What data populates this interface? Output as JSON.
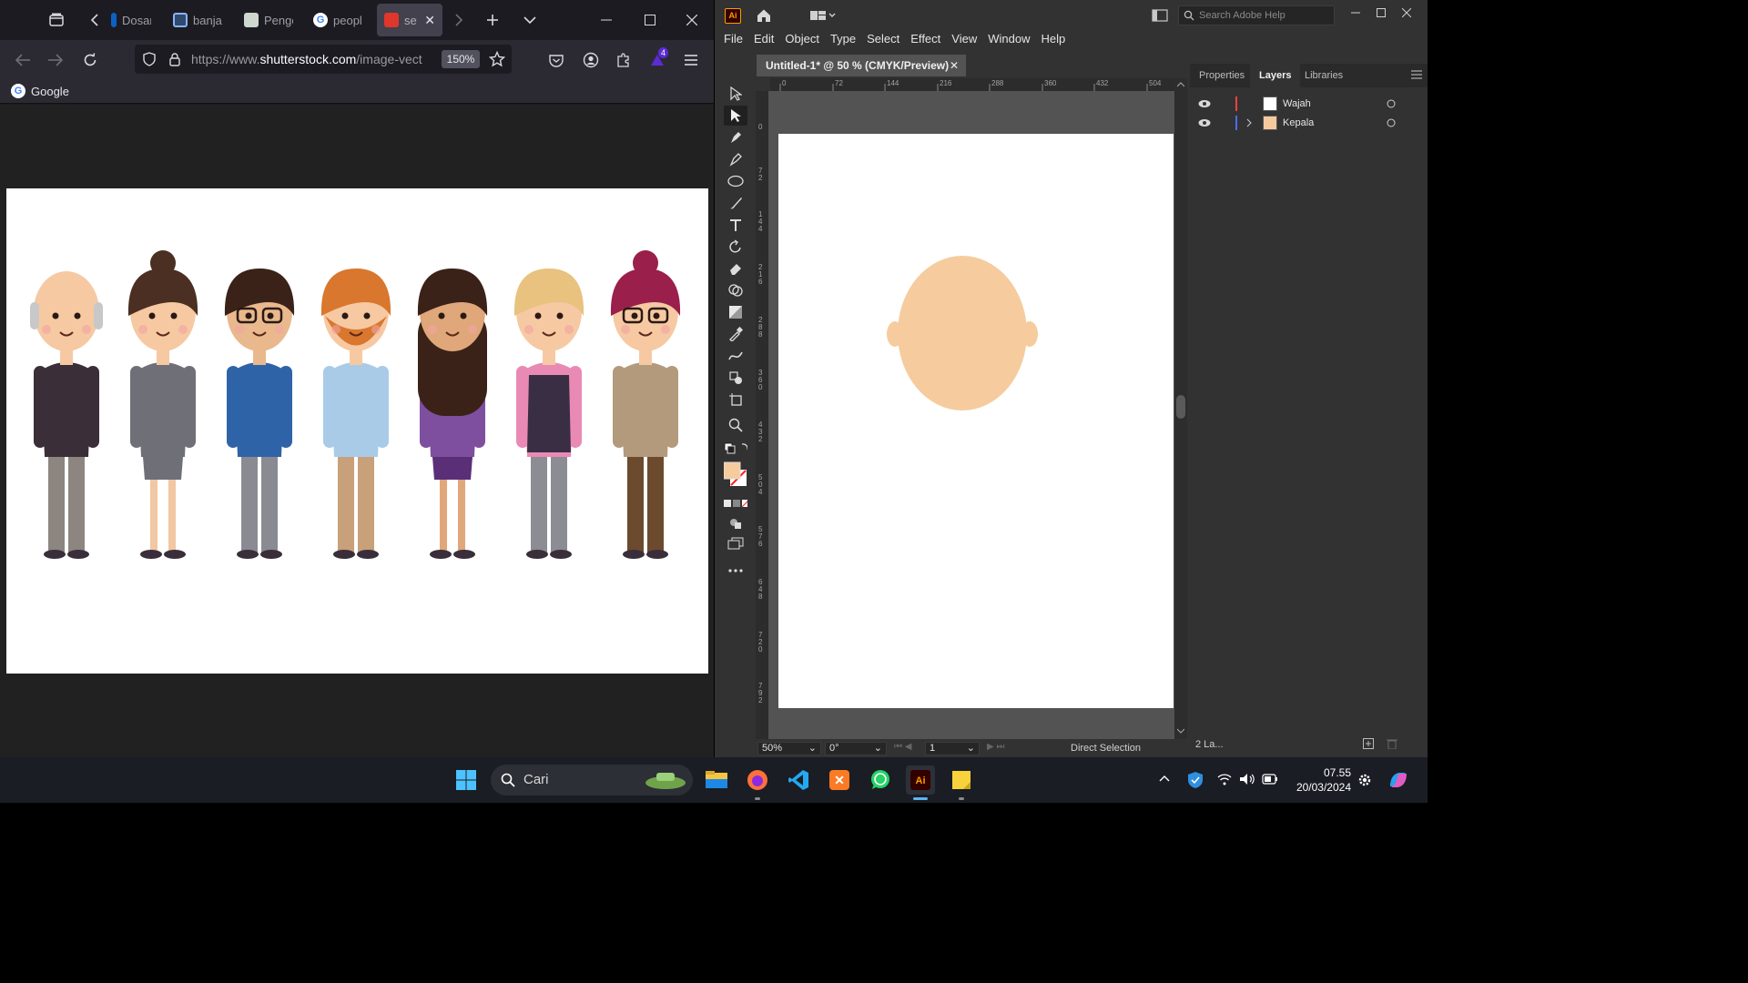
{
  "firefox": {
    "tabs": [
      {
        "label": "Dosan",
        "favicon_color": "#0a63c2"
      },
      {
        "label": "banjar",
        "favicon_color": "#8ab4f8"
      },
      {
        "label": "Penge",
        "favicon_color": "#7a9a7a"
      },
      {
        "label": "peopl",
        "favicon_color": "#4285f4"
      },
      {
        "label": "set",
        "favicon_color": "#e0362c",
        "active": true
      }
    ],
    "url_prefix": "https://www.",
    "url_domain": "shutterstock.com",
    "url_path": "/image-vect",
    "zoom": "150%",
    "extension_badge": "4",
    "bookmark": "Google",
    "people": [
      {
        "hair": "#c8c8c8",
        "skin": "#f6c9a2",
        "top": "#3a2e38",
        "pants": "#8c8580",
        "glasses": false,
        "beard": false,
        "bald": true
      },
      {
        "hair": "#4a2f22",
        "skin": "#f6c9a2",
        "top": "#6f6f78",
        "pants": "#f2c7a3",
        "glasses": false,
        "beard": false,
        "bun": true,
        "skirt": "#6f6f78"
      },
      {
        "hair": "#3a2218",
        "skin": "#e9b88c",
        "top": "#2f63a8",
        "pants": "#8a8a92",
        "glasses": true,
        "beard": false
      },
      {
        "hair": "#d9772e",
        "skin": "#f6c9a2",
        "top": "#a9cbe8",
        "pants": "#c8a07a",
        "glasses": false,
        "beard": true
      },
      {
        "hair": "#3a2218",
        "skin": "#e0a77a",
        "top": "#7e4f9e",
        "pants": "#e0a77a",
        "glasses": false,
        "beard": false,
        "long": true,
        "skirt": "#5a2f78"
      },
      {
        "hair": "#e8c27e",
        "skin": "#f6c9a2",
        "top": "#e98ab4",
        "pants": "#8c8c94",
        "glasses": false,
        "beard": false,
        "vest": "#3a2e44"
      },
      {
        "hair": "#9a1f4a",
        "skin": "#f6c9a2",
        "top": "#b49a7c",
        "pants": "#6b4a2e",
        "glasses": true,
        "beard": false,
        "bun": true
      }
    ]
  },
  "illustrator": {
    "search_placeholder": "Search Adobe Help",
    "menu": [
      "File",
      "Edit",
      "Object",
      "Type",
      "Select",
      "Effect",
      "View",
      "Window",
      "Help"
    ],
    "doc_tab": "Untitled-1* @ 50 % (CMYK/Preview)",
    "ruler_top": [
      "0",
      "72",
      "144",
      "216",
      "288",
      "360",
      "432",
      "504"
    ],
    "ruler_left": [
      "0",
      "72",
      "144",
      "216",
      "288",
      "360",
      "432",
      "504",
      "576",
      "648",
      "720",
      "792"
    ],
    "panel_tabs": [
      "Properties",
      "Layers",
      "Libraries"
    ],
    "layers": [
      {
        "name": "Wajah",
        "color": "#ff4040",
        "thumb": "#ffffff"
      },
      {
        "name": "Kepala",
        "color": "#4a6cff",
        "thumb": "#f5c99e"
      }
    ],
    "layer_count": "2 La...",
    "status_zoom": "50%",
    "status_rotation": "0°",
    "status_artboard": "1",
    "status_tool": "Direct Selection",
    "head_color": "#f6cc9e",
    "fill_color": "#f6cc9e"
  },
  "taskbar": {
    "search": "Cari",
    "time": "07.55",
    "date": "20/03/2024"
  }
}
